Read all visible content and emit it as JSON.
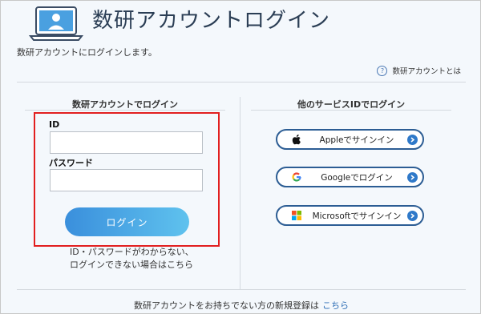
{
  "header": {
    "title": "数研アカウントログイン",
    "icon": "user-laptop-icon"
  },
  "intro_text": "数研アカウントにログインします。",
  "about_link": "数研アカウントとは",
  "left": {
    "title": "数研アカウントでログイン",
    "id_label": "ID",
    "id_value": "",
    "password_label": "パスワード",
    "password_value": "",
    "login_button": "ログイン",
    "forgot_line1": "ID・パスワードがわからない、",
    "forgot_line2": "ログインできない場合はこちら"
  },
  "right": {
    "title": "他のサービスIDでログイン",
    "buttons": [
      {
        "label": "Appleでサインイン",
        "icon": "apple-icon"
      },
      {
        "label": "Googleでログイン",
        "icon": "google-icon"
      },
      {
        "label": "Microsoftでサインイン",
        "icon": "microsoft-icon"
      }
    ]
  },
  "footer": {
    "text": "数研アカウントをお持ちでない方の新規登録は",
    "link": "こちら"
  },
  "colors": {
    "accent": "#2c5d94",
    "highlight_border": "#e21f1f",
    "button_start": "#3a8fdc",
    "button_end": "#5fc2ee"
  }
}
